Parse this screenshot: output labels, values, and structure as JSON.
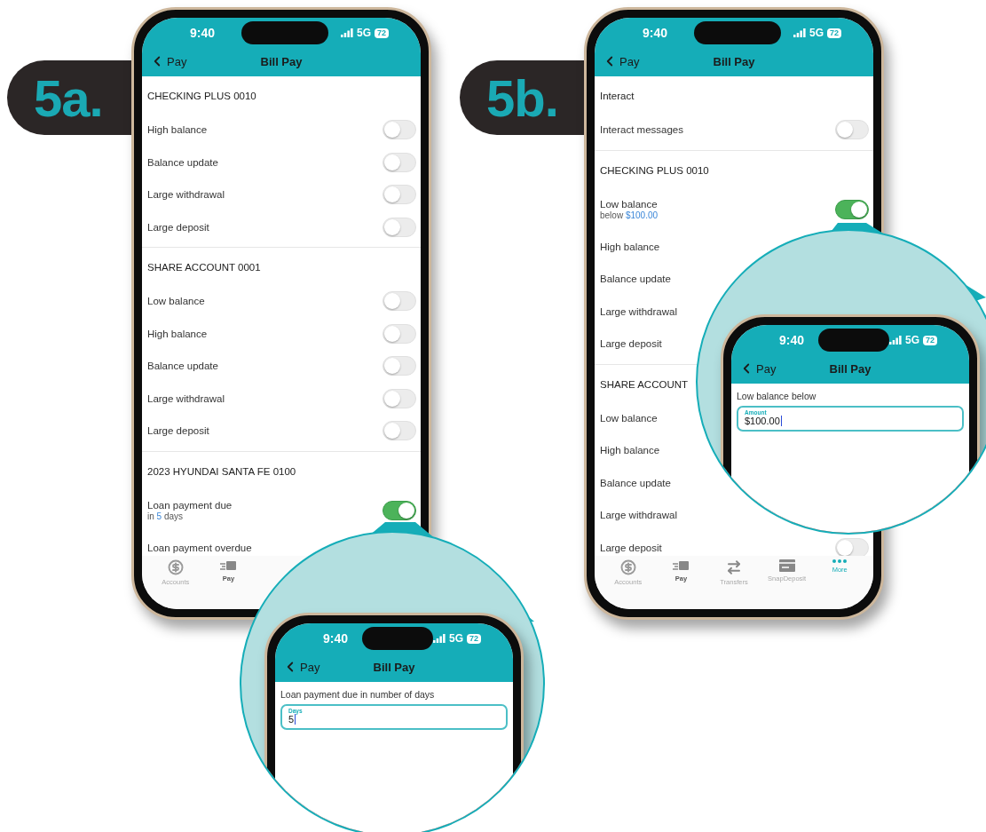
{
  "panels": [
    {
      "badge": "5a.",
      "phone": {
        "status": {
          "time": "9:40",
          "network": "5G",
          "battery": "72"
        },
        "nav": {
          "back": "Pay",
          "title": "Bill Pay"
        },
        "sections": [
          {
            "title": "CHECKING PLUS 0010",
            "rows": [
              {
                "label": "High balance",
                "on": false
              },
              {
                "label": "Balance update",
                "on": false
              },
              {
                "label": "Large withdrawal",
                "on": false
              },
              {
                "label": "Large deposit",
                "on": false
              }
            ]
          },
          {
            "title": "SHARE ACCOUNT 0001",
            "rows": [
              {
                "label": "Low balance",
                "on": false
              },
              {
                "label": "High balance",
                "on": false
              },
              {
                "label": "Balance update",
                "on": false
              },
              {
                "label": "Large withdrawal",
                "on": false
              },
              {
                "label": "Large deposit",
                "on": false
              }
            ]
          },
          {
            "title": "2023 HYUNDAI SANTA FE 0100",
            "rows": [
              {
                "label": "Loan payment due",
                "detail": {
                  "before": "in",
                  "value": "5",
                  "after": "days"
                },
                "on": true
              },
              {
                "label": "Loan payment overdue"
              }
            ]
          }
        ],
        "tabs": [
          {
            "kind": "dollar",
            "label": "Accounts",
            "selected": false,
            "bold": false
          },
          {
            "kind": "pay",
            "label": "Pay",
            "selected": false,
            "bold": true
          }
        ]
      },
      "zoom": {
        "status": {
          "time": "9:40",
          "network": "5G",
          "battery": "72"
        },
        "nav": {
          "back": "Pay",
          "title": "Bill Pay"
        },
        "prompt": "Loan payment due in number of days",
        "field": {
          "label": "Days",
          "value": "5"
        }
      }
    },
    {
      "badge": "5b.",
      "phone": {
        "status": {
          "time": "9:40",
          "network": "5G",
          "battery": "72"
        },
        "nav": {
          "back": "Pay",
          "title": "Bill Pay"
        },
        "sections": [
          {
            "title": "Interact",
            "rows": [
              {
                "label": "Interact messages",
                "on": false
              }
            ]
          },
          {
            "title": "CHECKING PLUS 0010",
            "rows": [
              {
                "label": "Low balance",
                "detail": {
                  "before": "below",
                  "value": "$100.00"
                },
                "on": true
              },
              {
                "label": "High balance"
              },
              {
                "label": "Balance update"
              },
              {
                "label": "Large withdrawal"
              },
              {
                "label": "Large deposit"
              }
            ]
          },
          {
            "title": "SHARE ACCOUNT",
            "rows": [
              {
                "label": "Low balance"
              },
              {
                "label": "High balance"
              },
              {
                "label": "Balance update"
              },
              {
                "label": "Large withdrawal"
              },
              {
                "label": "Large deposit",
                "on": false
              }
            ]
          }
        ],
        "tabs": [
          {
            "kind": "dollar",
            "label": "Accounts",
            "selected": false,
            "bold": false
          },
          {
            "kind": "pay",
            "label": "Pay",
            "selected": false,
            "bold": true
          },
          {
            "kind": "transfers",
            "label": "Transfers",
            "selected": false,
            "bold": false
          },
          {
            "kind": "card",
            "label": "SnapDeposit",
            "selected": false,
            "bold": false
          },
          {
            "kind": "more",
            "label": "More",
            "selected": true,
            "bold": false
          }
        ]
      },
      "zoom": {
        "status": {
          "time": "9:40",
          "network": "5G",
          "battery": "72"
        },
        "nav": {
          "back": "Pay",
          "title": "Bill Pay"
        },
        "prompt": "Low balance below",
        "field": {
          "label": "Amount",
          "value": "$100.00"
        }
      }
    }
  ]
}
